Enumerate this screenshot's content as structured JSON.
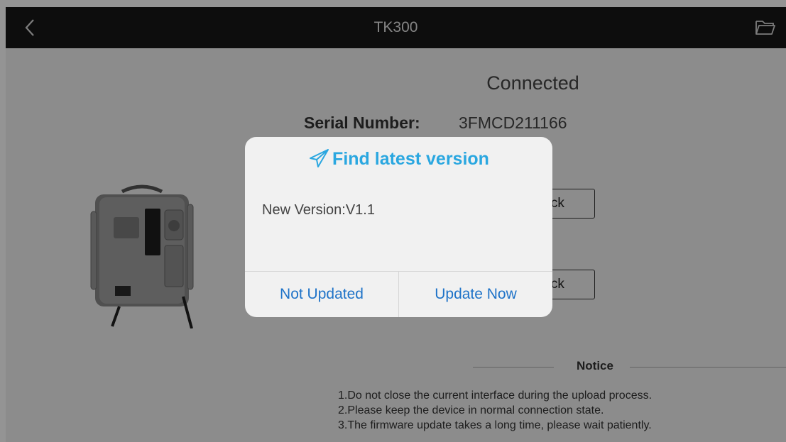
{
  "header": {
    "title": "TK300",
    "back_icon": "chevron-left-icon",
    "folder_icon": "folder-open-icon"
  },
  "device": {
    "status": "Connected",
    "serial_label": "Serial Number:",
    "serial_value": "3FMCD211166",
    "image_icon": "device-photo"
  },
  "buttons": {
    "check_1": "Check",
    "check_2": "Check"
  },
  "notice": {
    "title": "Notice",
    "items": [
      "1.Do not close the current interface during the upload process.",
      "2.Please keep the device in normal connection state.",
      "3.The firmware update takes a long time, please wait patiently."
    ]
  },
  "dialog": {
    "icon": "send-icon",
    "title": "Find latest version",
    "message": "New Version:V1.1",
    "cancel_label": "Not Updated",
    "confirm_label": "Update Now",
    "accent_color": "#2aa7e0",
    "button_color": "#1f73c8"
  }
}
